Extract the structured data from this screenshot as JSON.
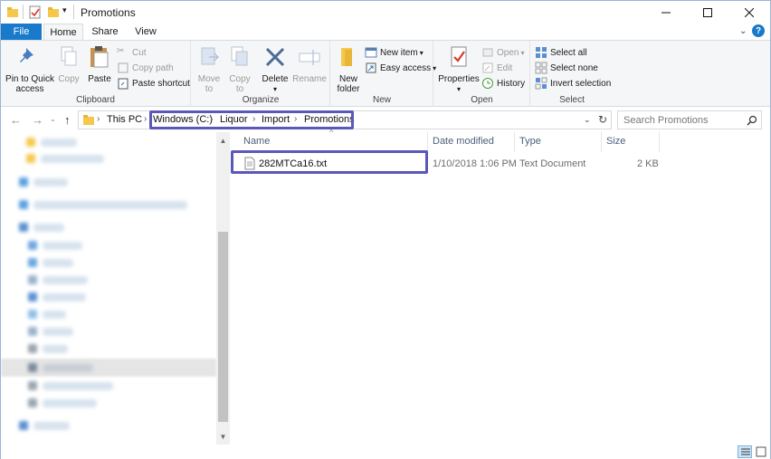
{
  "window": {
    "title": "Promotions"
  },
  "ribbon_tabs": {
    "file": "File",
    "home": "Home",
    "share": "Share",
    "view": "View"
  },
  "ribbon": {
    "clipboard": {
      "label": "Clipboard",
      "pin": "Pin to Quick access",
      "pin_l1": "Pin to Quick",
      "pin_l2": "access",
      "copy": "Copy",
      "paste": "Paste",
      "cut": "Cut",
      "copy_path": "Copy path",
      "paste_shortcut": "Paste shortcut"
    },
    "organize": {
      "label": "Organize",
      "move_to": "Move",
      "move_to2": "to",
      "copy_to": "Copy",
      "copy_to2": "to",
      "delete": "Delete",
      "rename": "Rename"
    },
    "new": {
      "label": "New",
      "new_folder_l1": "New",
      "new_folder_l2": "folder",
      "new_item": "New item",
      "easy_access": "Easy access"
    },
    "open": {
      "label": "Open",
      "properties": "Properties",
      "open": "Open",
      "edit": "Edit",
      "history": "History"
    },
    "select": {
      "label": "Select",
      "select_all": "Select all",
      "select_none": "Select none",
      "invert": "Invert selection"
    }
  },
  "address": {
    "crumbs": [
      "This PC",
      "Windows (C:)",
      "Liquor",
      "Import",
      "Promotions"
    ]
  },
  "search": {
    "placeholder": "Search Promotions"
  },
  "columns": {
    "name": "Name",
    "date": "Date modified",
    "type": "Type",
    "size": "Size"
  },
  "files": [
    {
      "name": "282MTCa16.txt",
      "date": "1/10/2018 1:06 PM",
      "type": "Text Document",
      "size": "2 KB"
    }
  ],
  "colors": {
    "accent": "#1979ca",
    "highlight": "#5b58b8",
    "folder": "#f5c84a"
  }
}
